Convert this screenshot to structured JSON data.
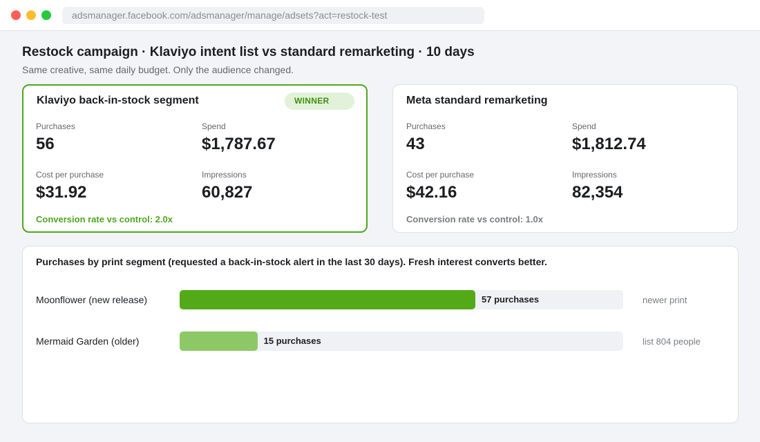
{
  "browser": {
    "url": "adsmanager.facebook.com/adsmanager/manage/adsets?act=restock-test"
  },
  "header": {
    "title": "Restock campaign  ·  Klaviyo intent list vs standard remarketing  ·  10 days",
    "subtitle": "Same creative, same daily budget. Only the audience changed."
  },
  "winner_card": {
    "name": "Klaviyo back-in-stock segment",
    "badge": "WINNER",
    "purchases_label": "Purchases",
    "purchases": "56",
    "spend_label": "Spend",
    "spend": "$1,787.67",
    "cpp_label": "Cost per purchase",
    "cpp": "$31.92",
    "impressions_label": "Impressions",
    "impressions": "60,827",
    "conversion": "Conversion rate vs control: 2.0x",
    "accent_color": "#4ea61e"
  },
  "control_card": {
    "name": "Meta standard remarketing",
    "purchases_label": "Purchases",
    "purchases": "43",
    "spend_label": "Spend",
    "spend": "$1,812.74",
    "cpp_label": "Cost per purchase",
    "cpp": "$42.16",
    "impressions_label": "Impressions",
    "impressions": "82,354",
    "conversion": "Conversion rate vs control: 1.0x"
  },
  "segments": {
    "title": "Purchases by print segment (requested a back-in-stock alert in the last 30 days). Fresh interest converts better.",
    "rows": [
      {
        "label": "Moonflower (new release)",
        "value": 57,
        "bar_text": "57 purchases",
        "note": "newer print",
        "color": "#53aa19"
      },
      {
        "label": "Mermaid Garden (older)",
        "value": 15,
        "bar_text": "15 purchases",
        "note": "list 804 people",
        "color": "#8cc966"
      }
    ]
  }
}
